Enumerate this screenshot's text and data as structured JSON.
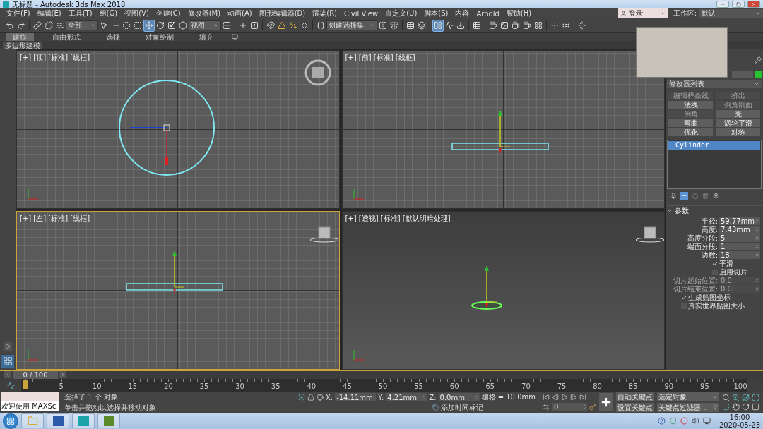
{
  "window": {
    "title": "无标题 - Autodesk 3ds Max 2018"
  },
  "menu_bar": {
    "items": [
      "文件(F)",
      "编辑(E)",
      "工具(T)",
      "组(G)",
      "视图(V)",
      "创建(C)",
      "修改器(M)",
      "动画(A)",
      "图形编辑器(D)",
      "渲染(R)",
      "Civil View",
      "自定义(U)",
      "脚本(S)",
      "内容",
      "Arnold",
      "帮助(H)"
    ],
    "sign_in": "登录",
    "workspace_label": "工作区:",
    "workspace_value": "默认"
  },
  "toolbar": {
    "items": [
      {
        "kind": "button",
        "selected": false
      },
      {
        "kind": "button",
        "selected": false
      },
      {
        "kind": "separator"
      },
      {
        "kind": "button",
        "selected": false
      },
      {
        "kind": "button",
        "selected": false
      },
      {
        "kind": "button",
        "selected": false
      },
      {
        "kind": "dropdown",
        "label": "全部"
      },
      {
        "kind": "button",
        "selected": false
      },
      {
        "kind": "button",
        "selected": false
      },
      {
        "kind": "button",
        "selected": false
      },
      {
        "kind": "button",
        "selected": false
      },
      {
        "kind": "button",
        "selected": true
      },
      {
        "kind": "button",
        "selected": false
      },
      {
        "kind": "button",
        "selected": false
      },
      {
        "kind": "button",
        "selected": false
      },
      {
        "kind": "dropdown",
        "label": "视图"
      },
      {
        "kind": "button",
        "selected": false
      },
      {
        "kind": "separator"
      },
      {
        "kind": "button",
        "selected": false
      },
      {
        "kind": "button",
        "selected": false
      },
      {
        "kind": "separator"
      },
      {
        "kind": "button",
        "selected": false
      },
      {
        "kind": "button",
        "selected": false
      },
      {
        "kind": "button",
        "selected": false
      },
      {
        "kind": "button",
        "selected": false
      },
      {
        "kind": "separator"
      },
      {
        "kind": "button",
        "selected": false
      },
      {
        "kind": "dropdown",
        "label": "创建选择集"
      },
      {
        "kind": "button",
        "selected": false
      },
      {
        "kind": "button",
        "selected": false
      },
      {
        "kind": "separator"
      },
      {
        "kind": "button",
        "selected": false
      },
      {
        "kind": "button",
        "selected": false
      },
      {
        "kind": "separator"
      },
      {
        "kind": "button",
        "selected": true
      },
      {
        "kind": "button",
        "selected": false
      },
      {
        "kind": "button",
        "selected": false
      },
      {
        "kind": "separator"
      },
      {
        "kind": "button",
        "selected": false
      },
      {
        "kind": "separator"
      },
      {
        "kind": "button",
        "selected": false
      },
      {
        "kind": "button",
        "selected": false
      },
      {
        "kind": "button",
        "selected": false
      },
      {
        "kind": "button",
        "selected": false
      },
      {
        "kind": "button",
        "selected": false
      },
      {
        "kind": "separator"
      },
      {
        "kind": "button",
        "selected": false
      },
      {
        "kind": "button",
        "selected": false
      },
      {
        "kind": "separator"
      },
      {
        "kind": "button",
        "selected": false
      }
    ]
  },
  "ribbon": {
    "tabs": [
      {
        "label": "建模",
        "selected": true
      },
      {
        "label": "自由形式",
        "selected": false
      },
      {
        "label": "选择",
        "selected": false
      },
      {
        "label": "对象绘制",
        "selected": false
      },
      {
        "label": "填充",
        "selected": false
      }
    ],
    "panel": "多边形建模"
  },
  "viewports": [
    {
      "kind": "top",
      "label": "[+] [顶] [标准] [线框]",
      "selected": false
    },
    {
      "kind": "front",
      "label": "[+] [前] [标准] [线框]",
      "selected": false
    },
    {
      "kind": "left",
      "label": "[+] [左] [标准] [线框]",
      "selected": true
    },
    {
      "kind": "perspective",
      "label": "[+] [透视] [标准] [默认明暗处理]",
      "selected": false
    }
  ],
  "command_panel": {
    "modifier_list": "修改器列表",
    "modifier_buttons": [
      {
        "label": "编辑样条线",
        "disabled": true
      },
      {
        "label": "挤出",
        "disabled": true
      },
      {
        "label": "法线",
        "disabled": false
      },
      {
        "label": "倒角剖面",
        "disabled": true
      },
      {
        "label": "倒角",
        "disabled": true
      },
      {
        "label": "壳",
        "disabled": false
      },
      {
        "label": "弯曲",
        "disabled": false
      },
      {
        "label": "涡轮平滑",
        "disabled": false
      },
      {
        "label": "优化",
        "disabled": false
      },
      {
        "label": "对称",
        "disabled": false
      }
    ],
    "stack": [
      {
        "label": "Cylinder",
        "selected": true
      }
    ],
    "rollout": {
      "title": "参数",
      "rows": [
        {
          "kind": "spinner",
          "label": "半径:",
          "value": "59.77mm",
          "disabled": false
        },
        {
          "kind": "spinner",
          "label": "高度:",
          "value": "7.43mm",
          "disabled": false
        },
        {
          "kind": "spinner",
          "label": "高度分段:",
          "value": "5",
          "disabled": false
        },
        {
          "kind": "spinner",
          "label": "端面分段:",
          "value": "1",
          "disabled": false
        },
        {
          "kind": "spinner",
          "label": "边数:",
          "value": "18",
          "disabled": false
        },
        {
          "kind": "checkbox",
          "label": "平滑",
          "checked": true
        },
        {
          "kind": "checkbox",
          "label": "启用切片",
          "checked": false
        },
        {
          "kind": "spinner",
          "label": "切片起始位置:",
          "value": "0.0",
          "disabled": true
        },
        {
          "kind": "spinner",
          "label": "切片结束位置:",
          "value": "0.0",
          "disabled": true
        },
        {
          "kind": "checkbox",
          "label": "生成贴图坐标",
          "checked": true
        },
        {
          "kind": "checkbox",
          "label": "真实世界贴图大小",
          "checked": false
        }
      ]
    }
  },
  "time_slider": {
    "position": "0 / 100",
    "level": 0
  },
  "track_bar": {
    "ticks": [
      "5",
      "10",
      "15",
      "20",
      "25",
      "30",
      "35",
      "40",
      "45",
      "50",
      "55",
      "60",
      "65",
      "70",
      "75",
      "80",
      "85",
      "90",
      "95",
      "100"
    ]
  },
  "status": {
    "listener": "欢迎使用 MAXSc",
    "message": "选择了 1 个 对象",
    "prompt": "单击并拖动以选择并移动对象",
    "x_label": "X:",
    "x": "-14.11mm",
    "y_label": "Y:",
    "y": "4.21mm",
    "z_label": "Z:",
    "z": "0.0mm",
    "grid": "栅格 = 10.0mm",
    "time_tag": "添加时间标记",
    "frame": "0",
    "auto_key": "自动关键点",
    "set_key": "设置关键点",
    "key_mode": "选定对象",
    "key_filters": "关键点过滤器..."
  },
  "taskbar": {
    "time": "16:00",
    "date": "2020-05-23"
  }
}
